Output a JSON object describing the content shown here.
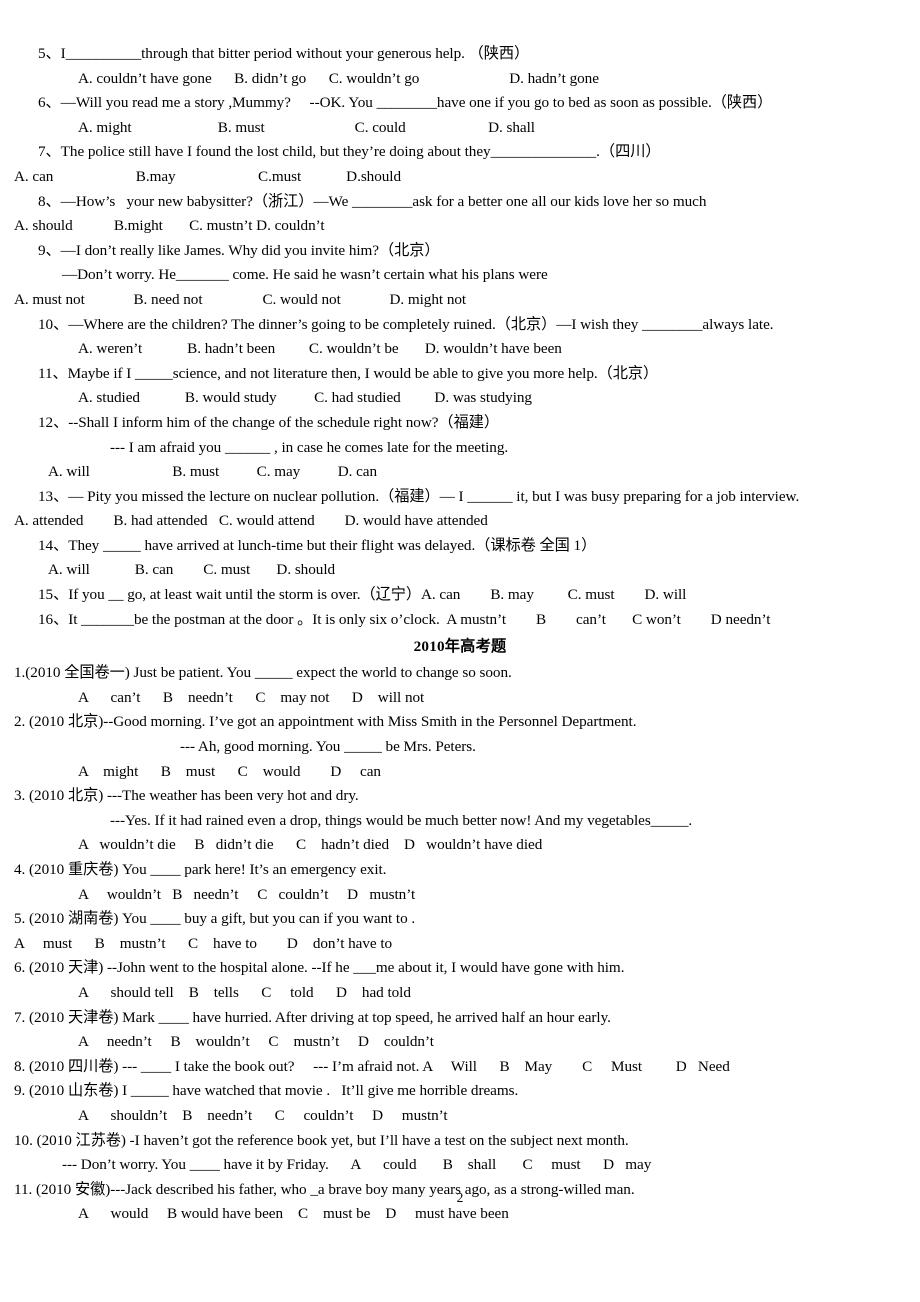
{
  "document": {
    "page_number": "2",
    "section_heading": "2010年高考题"
  },
  "block_2009": {
    "lines": [
      {
        "id": "q5_stem",
        "text": "5、I__________through that bitter period without your generous help. （陕西）"
      },
      {
        "id": "q5_options",
        "text": "A. couldn’t have gone      B. didn’t go      C. wouldn’t go                        D. hadn’t gone"
      },
      {
        "id": "q6_stem",
        "text": "6、—Will you read me a story ,Mummy?     --OK. You ________have one if you go to bed as soon as possible.（陕西）"
      },
      {
        "id": "q6_options",
        "text": "A. might                       B. must                        C. could                      D. shall"
      },
      {
        "id": "q7_stem",
        "text": "7、The police still have I found the lost child, but they’re doing about they______________.（四川）"
      },
      {
        "id": "q7_options",
        "text": "A. can                      B.may                      C.must            D.should"
      },
      {
        "id": "q8_stem",
        "text": "8、—How’s   your new babysitter?（浙江）—We ________ask for a better one all our kids love her so much"
      },
      {
        "id": "q8_options",
        "text": "A. should           B.might       C. mustn’t D. couldn’t"
      },
      {
        "id": "q9_stem",
        "text": "9、—I don’t really like James. Why did you invite him?（北京）"
      },
      {
        "id": "q9_stem2",
        "text": "—Don’t worry. He_______ come. He said he wasn’t certain what his plans were"
      },
      {
        "id": "q9_options",
        "text": "A. must not             B. need not                C. would not             D. might not"
      },
      {
        "id": "q10_stem",
        "text": "10、—Where are the children? The dinner’s going to be completely ruined.（北京）—I wish they ________always late."
      },
      {
        "id": "q10_options",
        "text": "A. weren’t            B. hadn’t been         C. wouldn’t be       D. wouldn’t have been"
      },
      {
        "id": "q11_stem",
        "text": "11、Maybe if I _____science, and not literature then, I would be able to give you more help.（北京）"
      },
      {
        "id": "q11_options",
        "text": "A. studied            B. would study          C. had studied         D. was studying"
      },
      {
        "id": "q12_stem",
        "text": "12、--Shall I inform him of the change of the schedule right now?（福建）"
      },
      {
        "id": "q12_stem2",
        "text": "--- I am afraid you ______ , in case he comes late for the meeting."
      },
      {
        "id": "q12_options",
        "text": "A. will                      B. must          C. may          D. can"
      },
      {
        "id": "q13_stem",
        "text": "13、— Pity you missed the lecture on nuclear pollution.（福建）— I ______ it, but I was busy preparing for a job interview."
      },
      {
        "id": "q13_options",
        "text": "A. attended        B. had attended   C. would attend        D. would have attended"
      },
      {
        "id": "q14_stem",
        "text": "14、They _____ have arrived at lunch-time but their flight was delayed.（课标卷 全国 1）"
      },
      {
        "id": "q14_options",
        "text": "A. will            B. can        C. must       D. should"
      },
      {
        "id": "q15_line",
        "text": "15、If you __ go, at least wait until the storm is over.（辽宁）A. can        B. may         C. must        D. will"
      },
      {
        "id": "q16_line",
        "text": "16、It _______be the postman at the door 。It is only six o’clock.  A mustn’t        B        can’t       C won’t        D needn’t"
      }
    ]
  },
  "block_2010": {
    "lines": [
      {
        "id": "p1_stem",
        "text": "1.(2010 全国卷一) Just be patient. You _____ expect the world to change so soon."
      },
      {
        "id": "p1_options",
        "text": "A      can’t      B    needn’t      C    may not      D    will not"
      },
      {
        "id": "p2_stem",
        "text": "2. (2010 北京)--Good morning. I’ve got an appointment with Miss Smith in the Personnel Department."
      },
      {
        "id": "p2_stem2",
        "text": "--- Ah, good morning. You _____ be Mrs. Peters."
      },
      {
        "id": "p2_options",
        "text": "A    might      B    must      C    would        D     can"
      },
      {
        "id": "p3_stem",
        "text": "3. (2010 北京) ---The weather has been very hot and dry."
      },
      {
        "id": "p3_stem2",
        "text": "---Yes. If it had rained even a drop, things would be much better now! And my vegetables_____."
      },
      {
        "id": "p3_options",
        "text": "A   wouldn’t die     B   didn’t die      C    hadn’t died    D   wouldn’t have died"
      },
      {
        "id": "p4_stem",
        "text": "4. (2010 重庆卷) You ____ park here! It’s an emergency exit."
      },
      {
        "id": "p4_options",
        "text": "A     wouldn’t   B   needn’t     C   couldn’t     D   mustn’t"
      },
      {
        "id": "p5_stem",
        "text": "5. (2010 湖南卷) You ____ buy a gift, but you can if you want to ."
      },
      {
        "id": "p5_options",
        "text": "A     must      B    mustn’t      C    have to        D    don’t have to"
      },
      {
        "id": "p6_stem",
        "text": "6. (2010 天津) --John went to the hospital alone. --If he ___me about it, I would have gone with him."
      },
      {
        "id": "p6_options",
        "text": "A      should tell    B    tells      C     told      D    had told"
      },
      {
        "id": "p7_stem",
        "text": "7. (2010 天津卷) Mark ____ have hurried. After driving at top speed, he arrived half an hour early."
      },
      {
        "id": "p7_options",
        "text": "A     needn’t     B    wouldn’t     C    mustn’t     D    couldn’t"
      },
      {
        "id": "p8_line",
        "text": "8. (2010 四川卷) --- ____ I take the book out?     --- I’m afraid not. A     Will      B    May        C     Must         D   Need"
      },
      {
        "id": "p9_stem",
        "text": "9. (2010 山东卷) I _____ have watched that movie .   It’ll give me horrible dreams."
      },
      {
        "id": "p9_options",
        "text": "A      shouldn’t    B    needn’t      C     couldn’t     D     mustn’t"
      },
      {
        "id": "p10_stem",
        "text": "10. (2010 江苏卷) -I haven’t got the reference book yet, but I’ll have a test on the subject next month."
      },
      {
        "id": "p10_line2",
        "text": "--- Don’t worry. You ____ have it by Friday.      A      could       B    shall       C     must      D   may"
      },
      {
        "id": "p11_stem",
        "text": "11. (2010 安徽)---Jack described his father, who _a brave boy many years ago, as a strong-willed man."
      },
      {
        "id": "p11_options",
        "text": "A      would     B would have been    C    must be    D     must have been"
      }
    ]
  }
}
